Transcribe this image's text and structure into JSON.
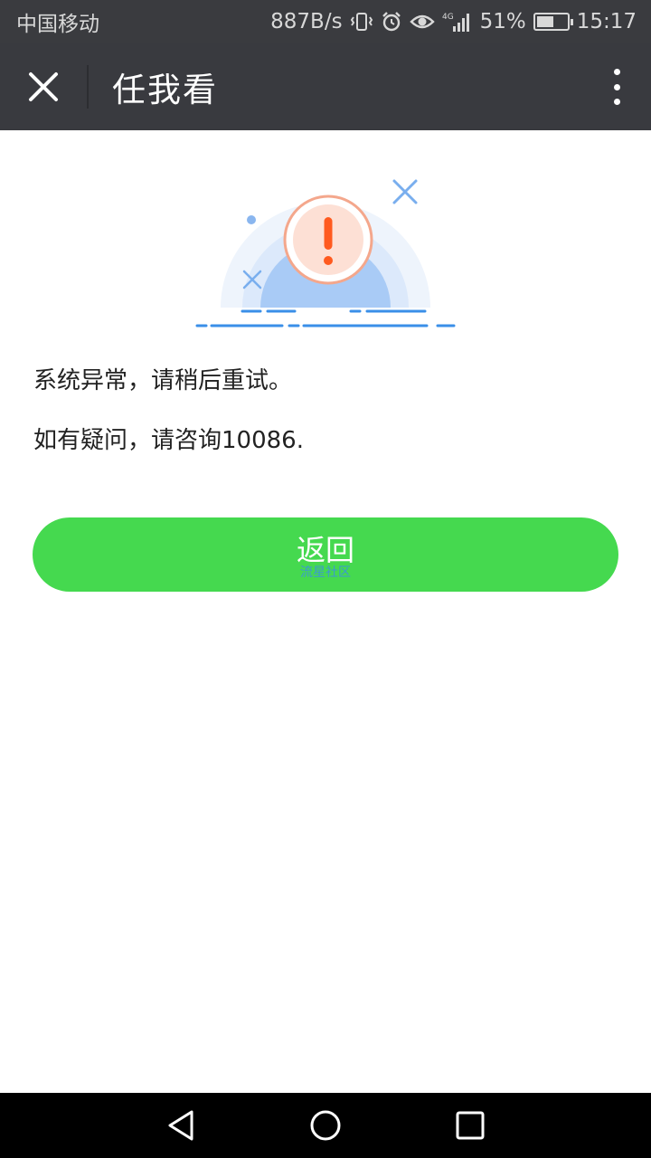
{
  "status": {
    "carrier": "中国移动",
    "net_speed": "887B/s",
    "network": "4G",
    "battery": "51%",
    "time": "15:17"
  },
  "nav": {
    "title": "任我看",
    "close_icon": "close-icon",
    "more_icon": "more-vertical-icon"
  },
  "content": {
    "error_message": "系统异常，请稍后重试。",
    "contact_message": "如有疑问，请咨询10086."
  },
  "button": {
    "label": "返回",
    "watermark": "流星社区",
    "color": "#45d94f"
  },
  "colors": {
    "header": "#393a3f",
    "alert": "#ff5a1f"
  }
}
